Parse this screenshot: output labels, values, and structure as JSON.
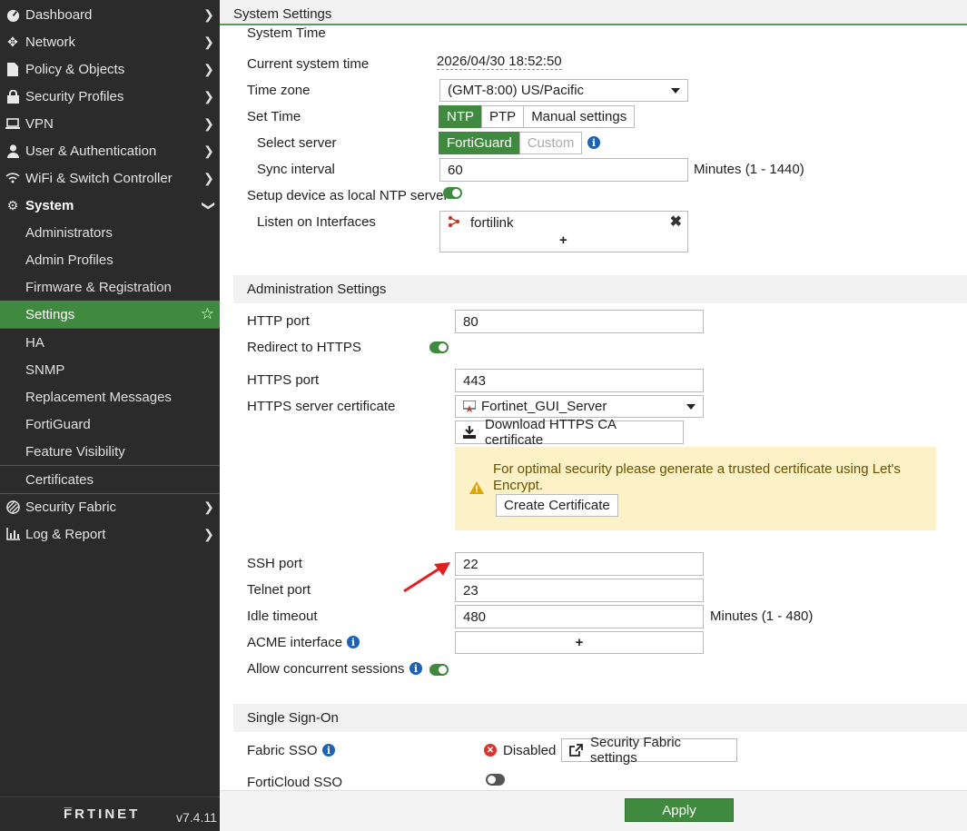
{
  "sidebar": {
    "nav": [
      {
        "label": "Dashboard",
        "icon": "dashboard-icon"
      },
      {
        "label": "Network",
        "icon": "network-icon"
      },
      {
        "label": "Policy & Objects",
        "icon": "policy-icon"
      },
      {
        "label": "Security Profiles",
        "icon": "lock-icon"
      },
      {
        "label": "VPN",
        "icon": "laptop-icon"
      },
      {
        "label": "User & Authentication",
        "icon": "user-icon"
      },
      {
        "label": "WiFi & Switch Controller",
        "icon": "wifi-icon"
      },
      {
        "label": "System",
        "icon": "gear-icon"
      }
    ],
    "system_items": [
      "Administrators",
      "Admin Profiles",
      "Firmware & Registration",
      "Settings",
      "HA",
      "SNMP",
      "Replacement Messages",
      "FortiGuard",
      "Feature Visibility",
      "Certificates"
    ],
    "bottom_nav": [
      {
        "label": "Security Fabric",
        "icon": "fabric-icon"
      },
      {
        "label": "Log & Report",
        "icon": "chart-icon"
      }
    ],
    "logo": "F̅RTINET",
    "version": "v7.4.11"
  },
  "header": {
    "title": "System Settings"
  },
  "system_time": {
    "section_title": "System Time",
    "current_time_label": "Current system time",
    "current_time_value": "2026/04/30 18:52:50",
    "timezone_label": "Time zone",
    "timezone_value": "(GMT-8:00) US/Pacific",
    "set_time_label": "Set Time",
    "set_time_options": [
      "NTP",
      "PTP",
      "Manual settings"
    ],
    "select_server_label": "Select server",
    "server_options": [
      "FortiGuard",
      "Custom"
    ],
    "sync_interval_label": "Sync interval",
    "sync_interval_value": "60",
    "sync_interval_unit": "Minutes (1 - 1440)",
    "local_ntp_label": "Setup device as local NTP server",
    "listen_label": "Listen on Interfaces",
    "listen_interface": "fortilink",
    "add_symbol": "+"
  },
  "admin_settings": {
    "section_title": "Administration Settings",
    "http_port_label": "HTTP port",
    "http_port_value": "80",
    "redirect_label": "Redirect to HTTPS",
    "https_port_label": "HTTPS port",
    "https_port_value": "443",
    "https_cert_label": "HTTPS server certificate",
    "https_cert_value": "Fortinet_GUI_Server",
    "download_ca_label": "Download HTTPS CA certificate",
    "warning_text": "For optimal security please generate a trusted certificate using Let's Encrypt.",
    "create_cert_label": "Create Certificate",
    "ssh_port_label": "SSH port",
    "ssh_port_value": "22",
    "telnet_port_label": "Telnet port",
    "telnet_port_value": "23",
    "idle_timeout_label": "Idle timeout",
    "idle_timeout_value": "480",
    "idle_timeout_unit": "Minutes (1 - 480)",
    "acme_label": "ACME interface",
    "acme_add": "+",
    "concurrent_label": "Allow concurrent sessions"
  },
  "sso": {
    "section_title": "Single Sign-On",
    "fabric_sso_label": "Fabric SSO",
    "fabric_sso_status": "Disabled",
    "fabric_settings_label": "Security Fabric settings",
    "forticloud_sso_label": "FortiCloud SSO"
  },
  "apply_label": "Apply",
  "colors": {
    "accent": "#3f8a3f",
    "sidebar": "#2b2b2b",
    "warning_bg": "#fdf1c7",
    "info": "#1c63b7",
    "error": "#d9342b"
  }
}
